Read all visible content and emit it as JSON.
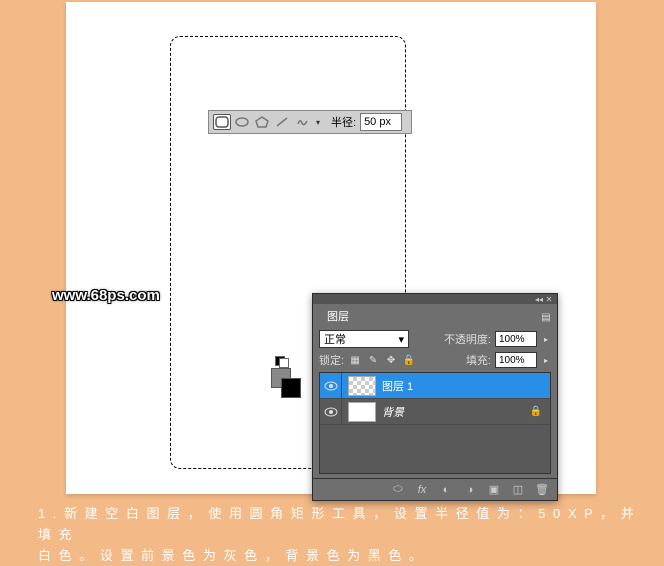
{
  "toolbar": {
    "radius_label": "半径:",
    "radius_value": "50 px",
    "shapes": [
      "rounded-rect",
      "ellipse",
      "polygon",
      "line",
      "custom"
    ]
  },
  "watermark": "www.68ps.com",
  "panel": {
    "tab": "图层",
    "blend_mode": "正常",
    "opacity_label": "不透明度:",
    "opacity_value": "100%",
    "lock_label": "锁定:",
    "fill_label": "填充:",
    "fill_value": "100%",
    "layers": [
      {
        "name": "图层 1",
        "selected": true,
        "checker": true,
        "locked": false
      },
      {
        "name": "背景",
        "selected": false,
        "checker": false,
        "locked": true
      }
    ]
  },
  "caption_line1": "1 . 新 建 空 白 图 层 ， 使 用 圆 角 矩 形 工 具 ， 设 置 半 径 值 为 ： 5 0 X P ， 并 填 充",
  "caption_line2": "白 色 。 设 置 前 景 色 为 灰 色 ， 背 景 色 为 黑 色 。"
}
